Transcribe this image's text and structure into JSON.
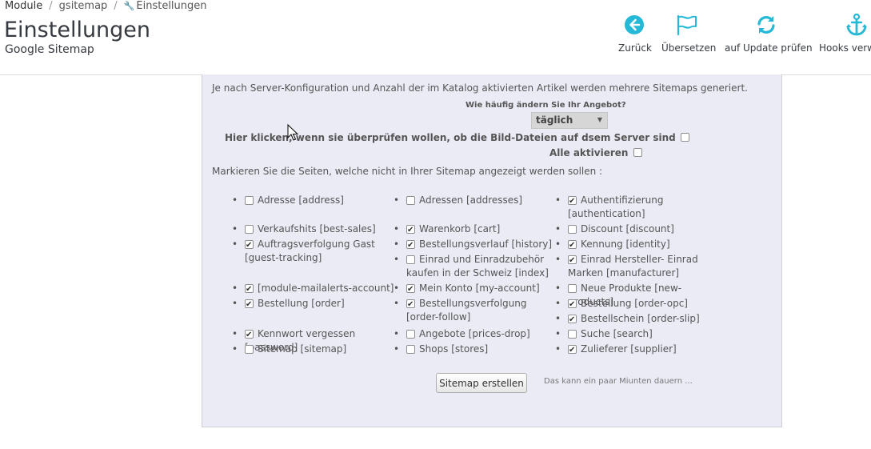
{
  "breadcrumb": {
    "items": [
      "Module",
      "gsitemap",
      "Einstellungen"
    ]
  },
  "header": {
    "title": "Einstellungen",
    "subtitle": "Google Sitemap"
  },
  "toolbar": {
    "back": "Zurück",
    "translate": "Übersetzen",
    "update": "auf Update prüfen",
    "hooks": "Hooks verw"
  },
  "form": {
    "info": "Je nach Server-Konfiguration und Anzahl der im Katalog aktivierten Artikel werden mehrere Sitemaps generiert.",
    "frequency_label": "Wie häufig ändern Sie Ihr Angebot?",
    "frequency_value": "täglich",
    "image_check_label": "Hier klicken, wenn sie überprüfen wollen, ob die Bild-Dateien auf dsem Server sind",
    "activate_all_label": "Alle aktivieren",
    "mark_pages_text": "Markieren Sie die Seiten, welche nicht in Ihrer Sitemap angezeigt werden sollen :",
    "pages": [
      {
        "label": "Adresse [address]",
        "checked": false
      },
      {
        "label": "Adressen [addresses]",
        "checked": false
      },
      {
        "label": "Authentifizierung [authentication]",
        "checked": true
      },
      {
        "label": "Verkaufshits [best-sales]",
        "checked": false
      },
      {
        "label": "Warenkorb [cart]",
        "checked": true
      },
      {
        "label": "Discount [discount]",
        "checked": false
      },
      {
        "label": "Auftragsverfolgung Gast [guest-tracking]",
        "checked": true
      },
      {
        "label": "Bestellungsverlauf [history]",
        "checked": true
      },
      {
        "label": "Kennung [identity]",
        "checked": true
      },
      {
        "label": "Einrad und Einradzubehör kaufen in der Schweiz [index]",
        "checked": false
      },
      {
        "label": "Einrad Hersteller- Einrad Marken [manufacturer]",
        "checked": true
      },
      {
        "label": "[module-mailalerts-account]",
        "checked": true
      },
      {
        "label": "Mein Konto [my-account]",
        "checked": true
      },
      {
        "label": "Neue Produkte [new-products]",
        "checked": false
      },
      {
        "label": "Bestellung [order]",
        "checked": true
      },
      {
        "label": "Bestellungsverfolgung [order-follow]",
        "checked": true
      },
      {
        "label": "Bestellung [order-opc]",
        "checked": true
      },
      {
        "label": "Kennwort vergessen [password]",
        "checked": true
      },
      {
        "label": "Angebote [prices-drop]",
        "checked": false
      },
      {
        "label": "Bestellschein [order-slip]",
        "checked": true
      },
      {
        "label": "Sitemap [sitemap]",
        "checked": false
      },
      {
        "label": "Shops [stores]",
        "checked": false
      },
      {
        "label": "Suche [search]",
        "checked": false
      },
      {
        "label": "Zulieferer [supplier]",
        "checked": true
      }
    ],
    "generate_button": "Sitemap erstellen",
    "generate_note": "Das kann ein paar Miunten dauern ..."
  },
  "colors": {
    "accent": "#25b9d7",
    "panel": "#ebebf6"
  }
}
